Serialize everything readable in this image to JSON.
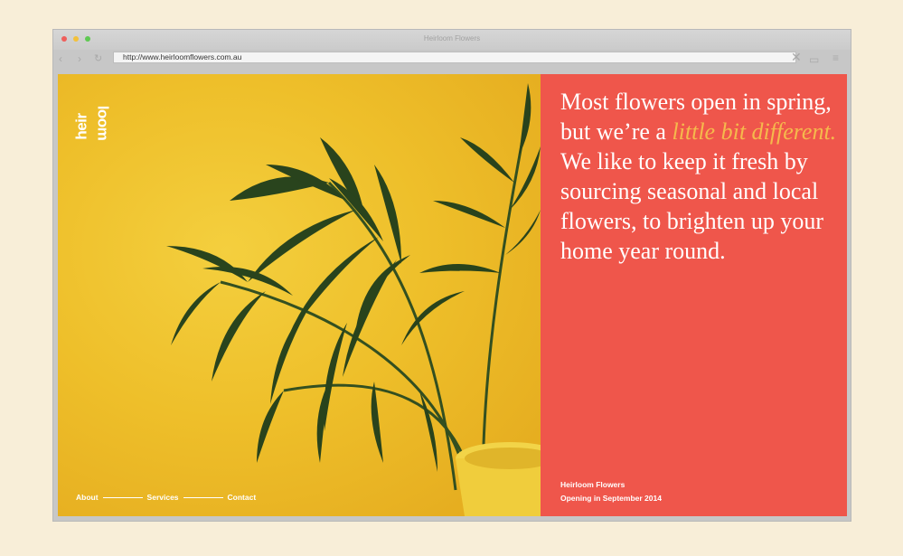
{
  "browser": {
    "window_title": "Heirloom Flowers",
    "url": "http://www.heirloomflowers.com.au",
    "icons": {
      "back": "‹",
      "forward": "›",
      "reload": "↻",
      "close": "✕",
      "tabs": "▭",
      "menu": "≡"
    }
  },
  "site": {
    "logo": {
      "line1": "heir",
      "line2": "loom"
    },
    "nav": [
      {
        "label": "About"
      },
      {
        "label": "Services"
      },
      {
        "label": "Contact"
      }
    ],
    "headline": {
      "part1": "Most flowers open in spring, but we’re a ",
      "highlight": "little bit different.",
      "part2": " We like to keep it fresh by sourcing seasonal and local flowers, to brighten up your home year round."
    },
    "footer": {
      "name": "Heirloom Flowers",
      "tagline": "Opening in September 2014"
    }
  },
  "colors": {
    "page_bg": "#f8eed8",
    "photo_yellow": "#eebf2a",
    "panel_red": "#ef564b",
    "highlight_gold": "#f5b94c",
    "leaf_green": "#1f3d1c"
  }
}
